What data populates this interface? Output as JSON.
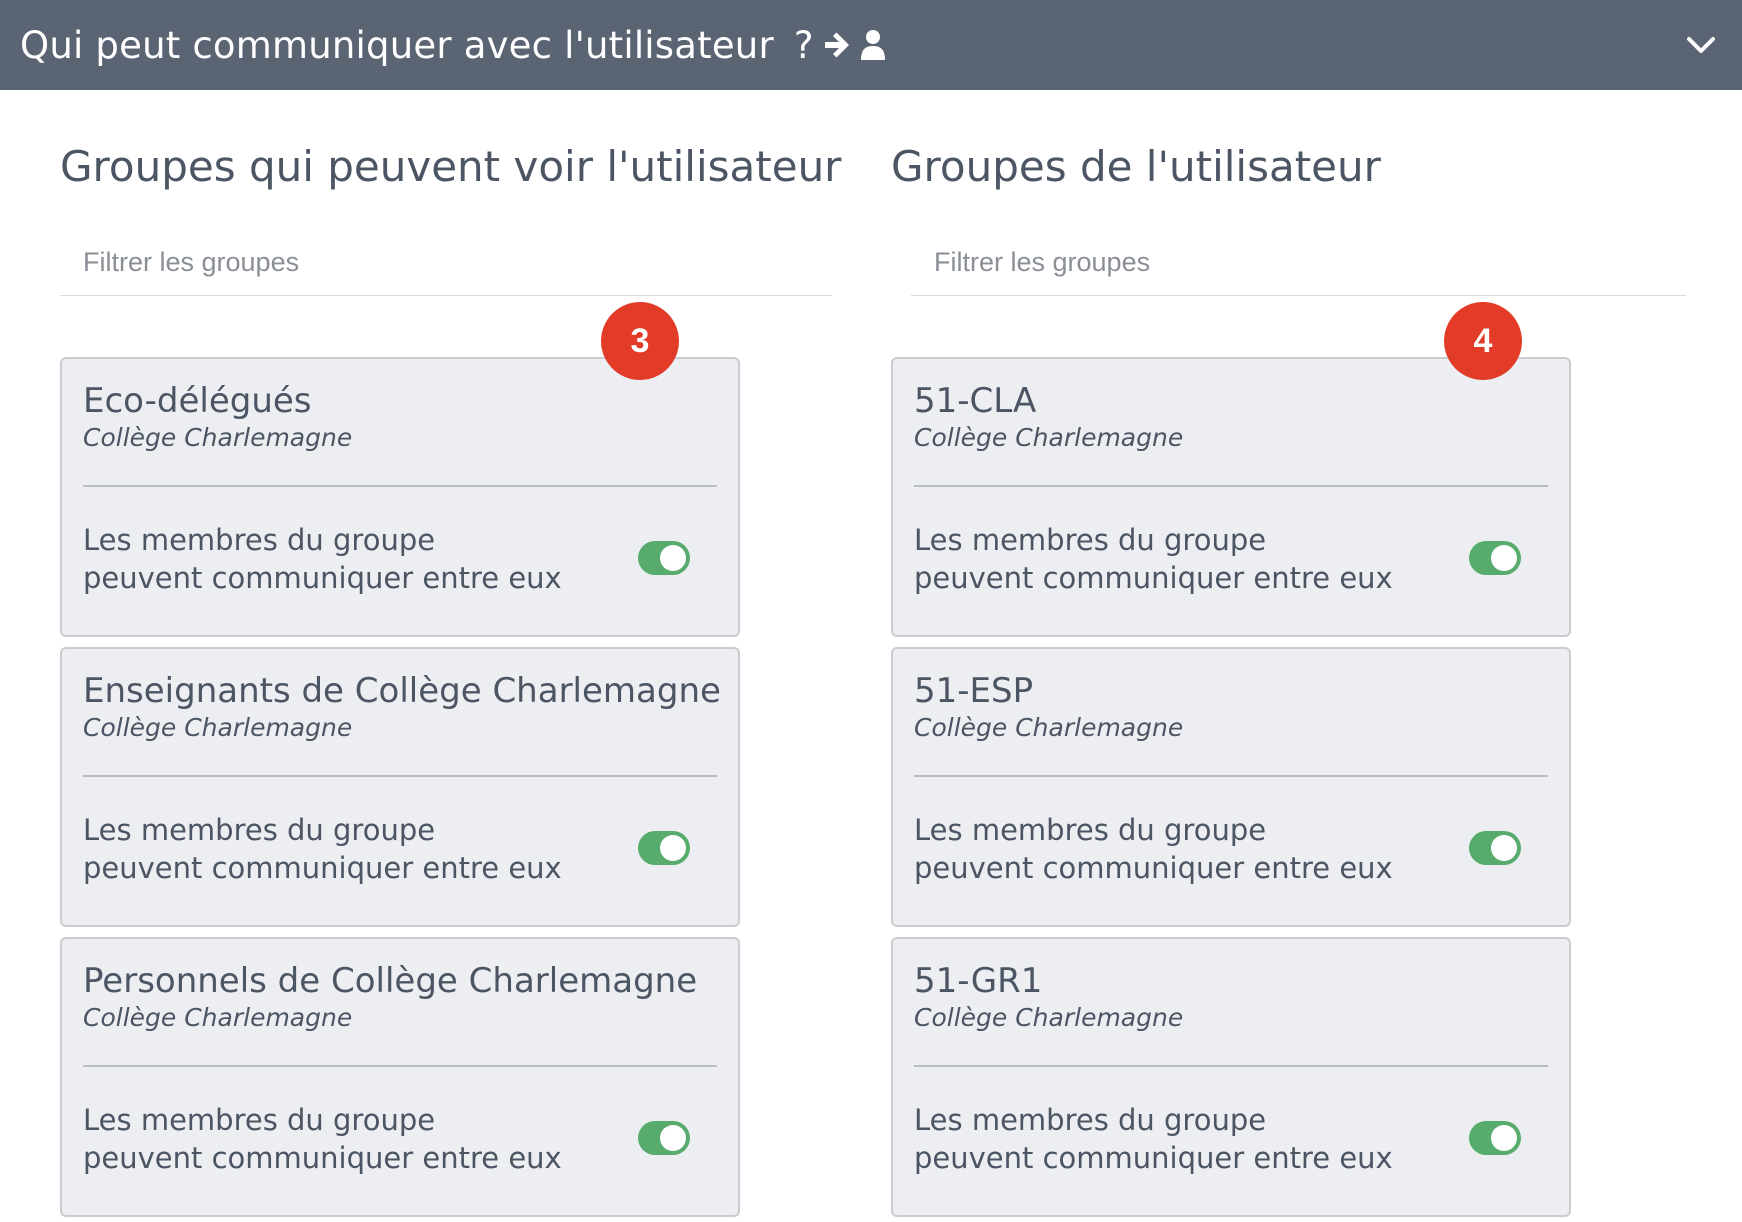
{
  "header": {
    "title": "Qui peut communiquer avec l'utilisateur",
    "question_mark": "?",
    "icons": [
      "arrow-right-icon",
      "user-icon"
    ],
    "collapse_icon": "chevron-down-icon",
    "background_color": "#5a6472"
  },
  "left": {
    "title": "Groupes qui peuvent voir l'utilisateur",
    "filter_placeholder": "Filtrer les groupes",
    "filter_value": "",
    "badge": "3",
    "groups": [
      {
        "name": "Eco-délégués",
        "school": "Collège Charlemagne",
        "toggle_label": "Les membres du groupe peuvent communiquer entre eux",
        "enabled": true
      },
      {
        "name": "Enseignants de Collège Charlemagne",
        "school": "Collège Charlemagne",
        "toggle_label": "Les membres du groupe peuvent communiquer entre eux",
        "enabled": true
      },
      {
        "name": "Personnels de Collège Charlemagne",
        "school": "Collège Charlemagne",
        "toggle_label": "Les membres du groupe peuvent communiquer entre eux",
        "enabled": true
      }
    ]
  },
  "right": {
    "title": "Groupes de l'utilisateur",
    "filter_placeholder": "Filtrer les groupes",
    "filter_value": "",
    "badge": "4",
    "groups": [
      {
        "name": "51-CLA",
        "school": "Collège Charlemagne",
        "toggle_label": "Les membres du groupe peuvent communiquer entre eux",
        "enabled": true
      },
      {
        "name": "51-ESP",
        "school": "Collège Charlemagne",
        "toggle_label": "Les membres du groupe peuvent communiquer entre eux",
        "enabled": true
      },
      {
        "name": "51-GR1",
        "school": "Collège Charlemagne",
        "toggle_label": "Les membres du groupe peuvent communiquer entre eux",
        "enabled": true
      }
    ]
  },
  "colors": {
    "badge": "#e23b27",
    "toggle_on": "#56ab6d",
    "card_bg": "#eceef1"
  }
}
